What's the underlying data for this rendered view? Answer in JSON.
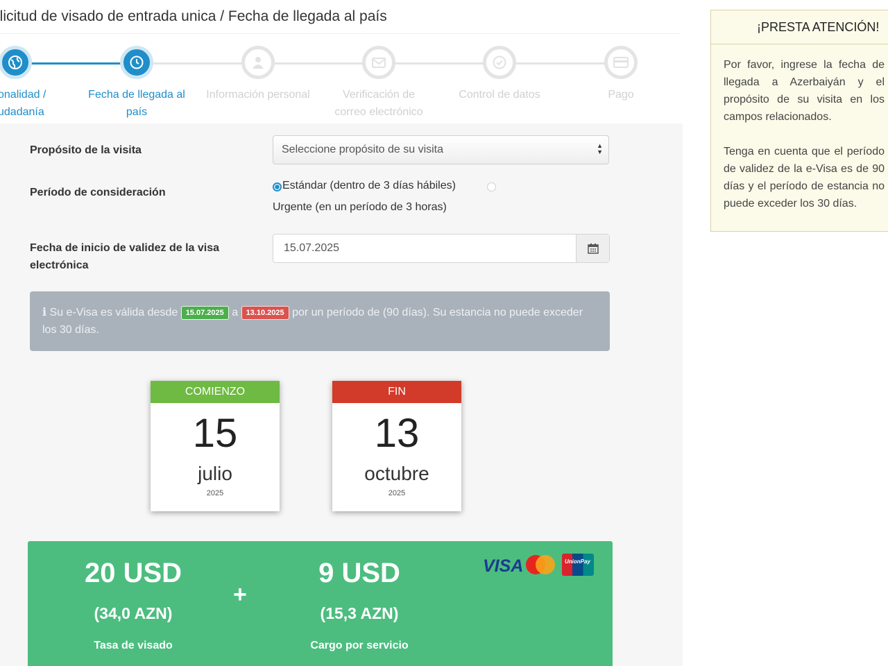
{
  "page": {
    "title": "olicitud de visado de entrada unica / Fecha de llegada al país"
  },
  "steps": [
    {
      "label": "onalidad / udadanía",
      "icon": "globe-icon",
      "state": "active"
    },
    {
      "label": "Fecha de llegada al país",
      "icon": "clock-icon",
      "state": "active"
    },
    {
      "label": "Información personal",
      "icon": "user-icon",
      "state": "inactive"
    },
    {
      "label": "Verificación de correo electrónico",
      "icon": "envelope-icon",
      "state": "inactive"
    },
    {
      "label": "Control de datos",
      "icon": "check-circle-icon",
      "state": "inactive"
    },
    {
      "label": "Pago",
      "icon": "credit-card-icon",
      "state": "inactive"
    }
  ],
  "form": {
    "purpose_label": "Propósito de la visita",
    "purpose_value": "Seleccione propósito de su visita",
    "period_label": "Período de consideración",
    "option_standard": "Estándar (dentro de 3 días hábiles)",
    "option_urgent": "Urgente (en un período de 3 horas)",
    "selected_option": "standard",
    "start_label": "Fecha de inicio de validez de la visa electrónica",
    "start_value": "15.07.2025"
  },
  "info": {
    "prefix": "ℹ Su e-Visa es válida desde",
    "from": "15.07.2025",
    "connector": "a",
    "to": "13.10.2025",
    "suffix": "por un período de (90 días). Su estancia no puede exceder los 30 días."
  },
  "calendar_start": {
    "header": "COMIENZO",
    "day": "15",
    "month": "julio",
    "year": "2025",
    "color": "#6fba43"
  },
  "calendar_end": {
    "header": "FIN",
    "day": "13",
    "month": "octubre",
    "year": "2025",
    "color": "#d23a2a"
  },
  "pricing": {
    "visa_fee": "20 USD",
    "visa_fee_azn": "(34,0 AZN)",
    "visa_fee_label": "Tasa de visado",
    "plus": "+",
    "service_fee": "9 USD",
    "service_fee_azn": "(15,3 AZN)",
    "service_fee_label": "Cargo por servicio",
    "card_visa": "VISA",
    "card_unionpay": "UnionPay",
    "background": "#4cbd7f"
  },
  "notice": {
    "title": "¡PRESTA ATENCIÓN!",
    "p1": "Por favor, ingrese la fecha de llegada a Azerbaiyán y el propósito de su visita en los campos relacionados.",
    "p2": "Tenga en cuenta que el período de validez de la e-Visa es de 90 días y el período de estancia no puede exceder los 30 días."
  },
  "colors": {
    "accent": "#1f8ec9",
    "info_bg": "#a9b2bb",
    "notice_bg": "#fcfbe9"
  }
}
